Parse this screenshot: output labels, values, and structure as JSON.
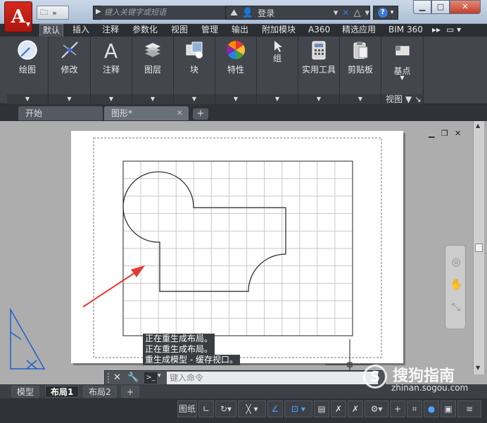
{
  "app": {
    "logo_letter": "A"
  },
  "titlebar": {
    "search_placeholder": "键入关键字或短语",
    "login_label": "登录",
    "help_label": "?"
  },
  "ribbon_tabs": [
    "默认",
    "插入",
    "注释",
    "参数化",
    "视图",
    "管理",
    "输出",
    "附加模块",
    "A360",
    "精选应用",
    "BIM 360"
  ],
  "ribbon_panels": [
    {
      "label": "绘图",
      "icon": "draw-circle-icon"
    },
    {
      "label": "修改",
      "icon": "modify-icon"
    },
    {
      "label": "注释",
      "icon": "annotation-A-icon"
    },
    {
      "label": "图层",
      "icon": "layers-icon"
    },
    {
      "label": "块",
      "icon": "block-icon"
    },
    {
      "label": "特性",
      "icon": "color-wheel-icon"
    },
    {
      "label": "组",
      "icon": "group-icon"
    },
    {
      "label": "实用工具",
      "icon": "calculator-icon"
    },
    {
      "label": "剪贴板",
      "icon": "clipboard-icon"
    },
    {
      "label": "基点",
      "icon": "basepoint-icon"
    }
  ],
  "view_panel_label": "视图",
  "file_tabs": [
    {
      "label": "开始",
      "active": false
    },
    {
      "label": "图形*",
      "active": true
    }
  ],
  "command_history": [
    "正在重生成布局。",
    "正在重生成布局。",
    "重生成模型 - 缓存视口。"
  ],
  "command_input_placeholder": "键入命令",
  "layout_tabs": [
    {
      "label": "模型",
      "active": false
    },
    {
      "label": "布局1",
      "active": true
    },
    {
      "label": "布局2",
      "active": false
    }
  ],
  "status": {
    "paper_label": "图纸"
  },
  "watermark": {
    "brand": "搜狗指南",
    "url": "zhinan.sogou.com"
  },
  "colors": {
    "accent_red": "#d7291d",
    "annotation_arrow": "#e53935",
    "grid_line": "#c8c8c8",
    "ucs_blue": "#1f5fd1"
  }
}
